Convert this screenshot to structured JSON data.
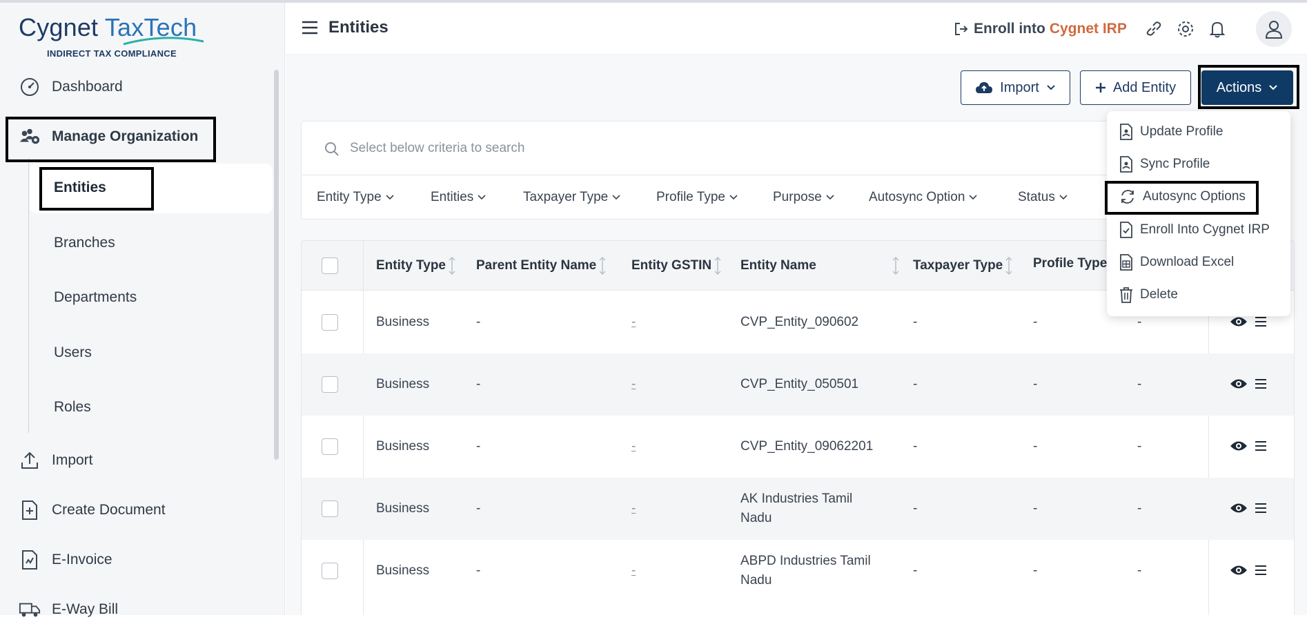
{
  "logo": {
    "brand_main": "Cygnet",
    "brand_second": "TaxTech",
    "tagline": "INDIRECT TAX COMPLIANCE"
  },
  "sidebar": {
    "items": [
      {
        "label": "Dashboard",
        "icon": "dashboard-gauge-icon"
      },
      {
        "label": "Manage Organization",
        "icon": "users-gear-icon"
      },
      {
        "label": "Import",
        "icon": "upload-icon"
      },
      {
        "label": "Create Document",
        "icon": "document-plus-icon"
      },
      {
        "label": "E-Invoice",
        "icon": "invoice-icon"
      },
      {
        "label": "E-Way Bill",
        "icon": "truck-icon"
      }
    ],
    "subitems": [
      "Entities",
      "Branches",
      "Departments",
      "Users",
      "Roles"
    ]
  },
  "header": {
    "title": "Entities",
    "enroll_prefix": "Enroll into",
    "enroll_accent": "Cygnet IRP"
  },
  "toolbar": {
    "import_label": "Import",
    "add_label": "Add Entity",
    "actions_label": "Actions"
  },
  "search": {
    "placeholder": "Select below criteria to search"
  },
  "filters": [
    "Entity Type",
    "Entities",
    "Taxpayer Type",
    "Profile Type",
    "Purpose",
    "Autosync Option",
    "Status"
  ],
  "table": {
    "columns": [
      "Entity Type",
      "Parent Entity Name",
      "Entity GSTIN",
      "Entity Name",
      "Taxpayer Type",
      "Profile Type"
    ],
    "rows": [
      {
        "entity_type": "Business",
        "parent": "-",
        "gstin": "-",
        "name": "CVP_Entity_090602",
        "taxpayer": "-",
        "profile": "-",
        "extra": "-"
      },
      {
        "entity_type": "Business",
        "parent": "-",
        "gstin": "-",
        "name": "CVP_Entity_050501",
        "taxpayer": "-",
        "profile": "-",
        "extra": "-"
      },
      {
        "entity_type": "Business",
        "parent": "-",
        "gstin": "-",
        "name": "CVP_Entity_09062201",
        "taxpayer": "-",
        "profile": "-",
        "extra": "-"
      },
      {
        "entity_type": "Business",
        "parent": "-",
        "gstin": "-",
        "name": "AK Industries Tamil Nadu",
        "taxpayer": "-",
        "profile": "-",
        "extra": "-"
      },
      {
        "entity_type": "Business",
        "parent": "-",
        "gstin": "-",
        "name": "ABPD Industries Tamil Nadu",
        "taxpayer": "-",
        "profile": "-",
        "extra": "-"
      }
    ]
  },
  "actions_menu": [
    "Update Profile",
    "Sync Profile",
    "Autosync Options",
    "Enroll Into Cygnet IRP",
    "Download Excel",
    "Delete"
  ],
  "colors": {
    "brand": "#0f3a66",
    "accent": "#d0693f"
  }
}
